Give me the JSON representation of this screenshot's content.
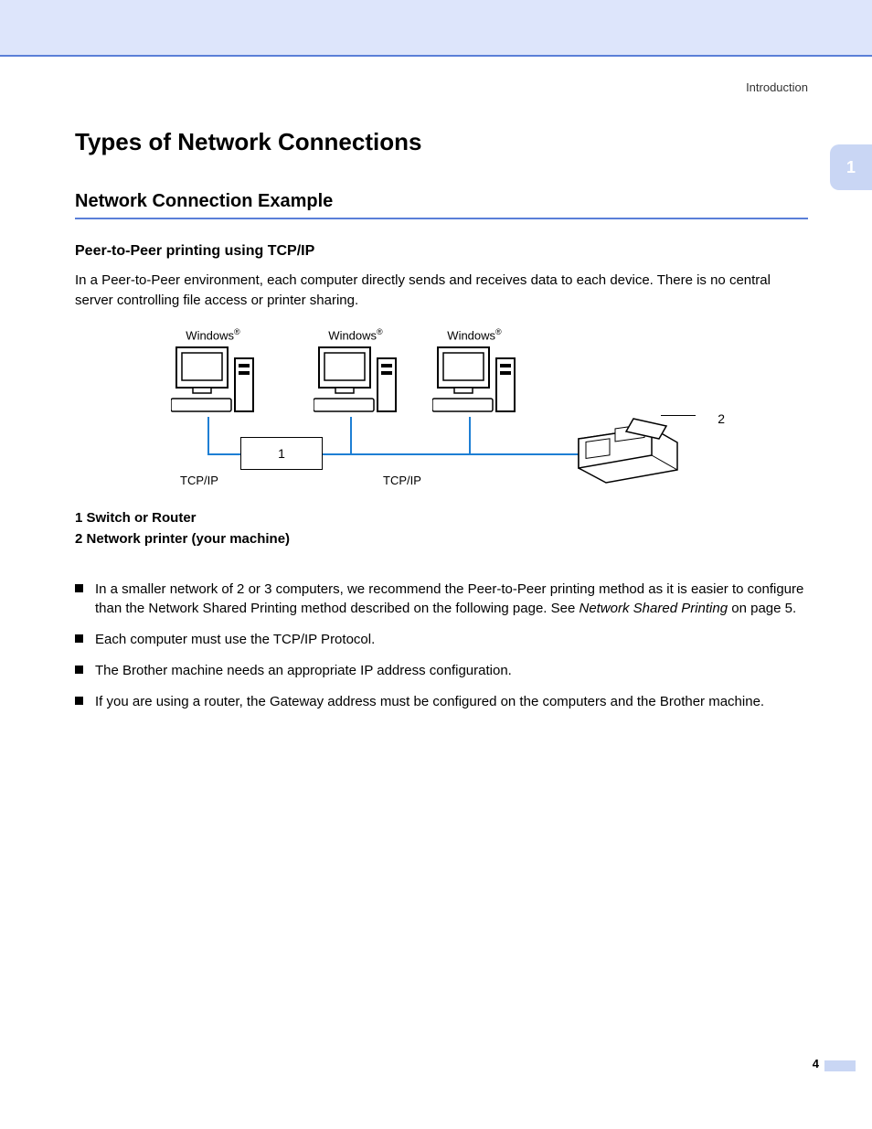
{
  "header": {
    "section_label": "Introduction",
    "chapter_number": "1"
  },
  "title": "Types of Network Connections",
  "section": "Network Connection Example",
  "subsection": "Peer-to-Peer printing using TCP/IP",
  "intro_paragraph": "In a Peer-to-Peer environment, each computer directly sends and receives data to each device. There is no central server controlling file access or printer sharing.",
  "diagram": {
    "os_label": "Windows",
    "os_reg": "®",
    "switch_num": "1",
    "protocol": "TCP/IP",
    "callout_printer": "2"
  },
  "legend": {
    "item1": "1  Switch or Router",
    "item2": "2  Network printer (your machine)"
  },
  "bullets": {
    "b1_part1": "In a smaller network of 2 or 3 computers, we recommend the Peer-to-Peer printing method as it is easier to configure than the Network Shared Printing method described on the following page. See ",
    "b1_italic": "Network Shared Printing",
    "b1_part2": " on page 5.",
    "b2": "Each computer must use the TCP/IP Protocol.",
    "b3": "The Brother machine needs an appropriate IP address configuration.",
    "b4": "If you are using a router, the Gateway address must be configured on the computers and the Brother machine."
  },
  "page_number": "4"
}
